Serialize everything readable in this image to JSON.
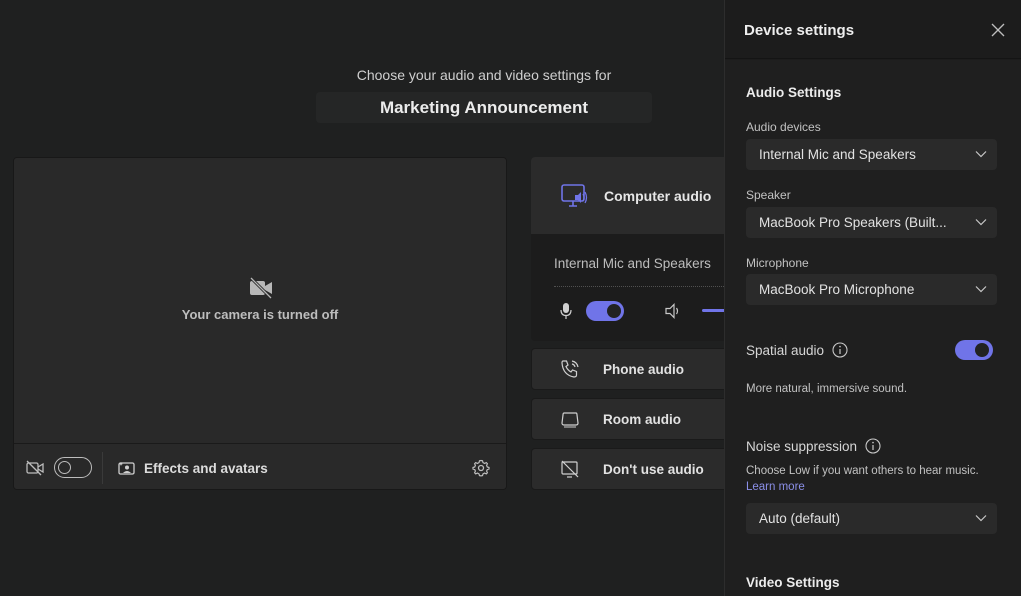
{
  "prejoin": {
    "prompt": "Choose your audio and video settings for",
    "meeting_title": "Marketing Announcement",
    "camera": {
      "status_text": "Your camera is turned off",
      "camera_toggle_on": false,
      "effects_label": "Effects and avatars"
    },
    "audio": {
      "computer_audio": {
        "label": "Computer audio",
        "device": "Internal Mic and Speakers",
        "mic_toggle_on": true
      },
      "options": [
        {
          "label": "Phone audio",
          "icon": "phone-icon"
        },
        {
          "label": "Room audio",
          "icon": "room-icon"
        },
        {
          "label": "Don't use audio",
          "icon": "no-audio-icon"
        }
      ]
    }
  },
  "panel": {
    "title": "Device settings",
    "audio_section_title": "Audio Settings",
    "audio_devices_label": "Audio devices",
    "audio_devices_value": "Internal Mic and Speakers",
    "speaker_label": "Speaker",
    "speaker_value": "MacBook Pro Speakers (Built...",
    "microphone_label": "Microphone",
    "microphone_value": "MacBook Pro Microphone",
    "spatial_audio_label": "Spatial audio",
    "spatial_audio_on": true,
    "spatial_audio_desc": "More natural, immersive sound.",
    "noise_label": "Noise suppression",
    "noise_desc": "Choose Low if you want others to hear music.",
    "noise_link": "Learn more",
    "noise_value": "Auto (default)",
    "video_section_title": "Video Settings"
  },
  "colors": {
    "accent": "#7074e8",
    "background": "#1f2020",
    "panel": "#1c1c1c"
  }
}
